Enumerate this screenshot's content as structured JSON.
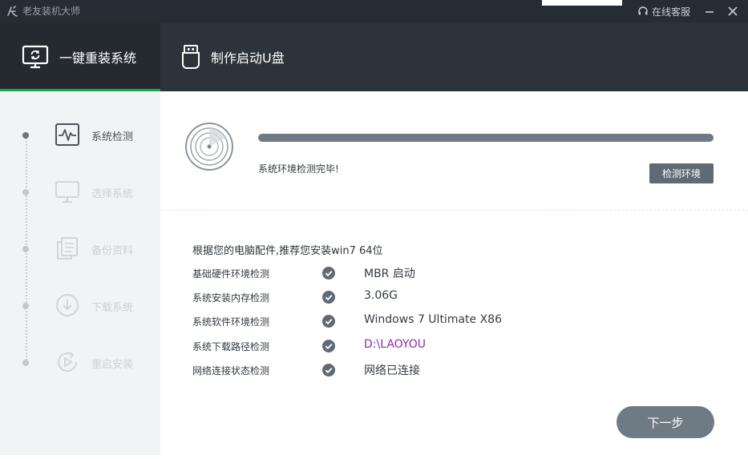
{
  "titlebar": {
    "app_title": "老友装机大师",
    "online_service": "在线客服"
  },
  "nav": {
    "tabs": [
      {
        "label": "一键重装系统",
        "icon": "monitor-refresh-icon",
        "active": true
      },
      {
        "label": "制作启动U盘",
        "icon": "usb-drive-icon",
        "active": false
      }
    ]
  },
  "sidebar": {
    "steps": [
      {
        "label": "系统检测",
        "icon": "pulse-monitor-icon",
        "active": true
      },
      {
        "label": "选择系统",
        "icon": "monitor-icon",
        "active": false
      },
      {
        "label": "备份资料",
        "icon": "copy-docs-icon",
        "active": false
      },
      {
        "label": "下载系统",
        "icon": "download-circle-icon",
        "active": false
      },
      {
        "label": "重启安装",
        "icon": "restart-play-icon",
        "active": false
      }
    ]
  },
  "detection": {
    "progress": 1.0,
    "status": "系统环境检测完毕!",
    "detect_button": "检测环境"
  },
  "recommendation": "根据您的电脑配件,推荐您安装win7 64位",
  "checks": [
    {
      "label": "基础硬件环境检测",
      "value": "MBR 启动"
    },
    {
      "label": "系统安装内存检测",
      "value": "3.06G"
    },
    {
      "label": "系统软件环境检测",
      "value": "Windows 7 Ultimate X86"
    },
    {
      "label": "系统下载路径检测",
      "value": "D:\\LAOYOU"
    },
    {
      "label": "网络连接状态检测",
      "value": "网络已连接"
    }
  ],
  "next_button": "下一步",
  "colors": {
    "accent_green": "#1aa54b",
    "path_purple": "#8e2aa8",
    "header_dark": "#2d333a",
    "button_gray": "#6e7a84"
  }
}
